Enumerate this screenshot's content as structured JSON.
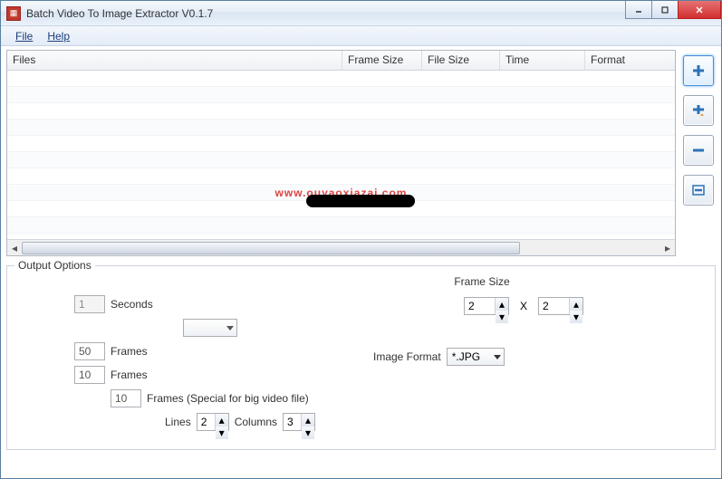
{
  "window": {
    "title": "Batch Video To Image Extractor V0.1.7"
  },
  "menu": {
    "file": "File",
    "help": "Help"
  },
  "table": {
    "cols": {
      "files": "Files",
      "frameSize": "Frame Size",
      "fileSize": "File Size",
      "time": "Time",
      "format": "Format"
    }
  },
  "watermark": "www.ouyaoxiazai.com",
  "sidebuttons": [
    "plus-icon",
    "plus-star-icon",
    "minus-icon",
    "minus-all-icon"
  ],
  "output": {
    "legend": "Output Options",
    "secondsVal": "1",
    "secondsLabel": "Seconds",
    "frames1": "50",
    "frames2": "10",
    "framesLabel": "Frames",
    "framesSpecial": "10",
    "framesSpecialLabel": "Frames (Special for big video file)",
    "linesLabel": "Lines",
    "linesVal": "2",
    "columnsLabel": "Columns",
    "columnsVal": "3",
    "frameSizeTitle": "Frame Size",
    "w": "2",
    "h": "2",
    "x": "X",
    "imageFormatLabel": "Image Format",
    "imageFormatVal": "*.JPG"
  }
}
